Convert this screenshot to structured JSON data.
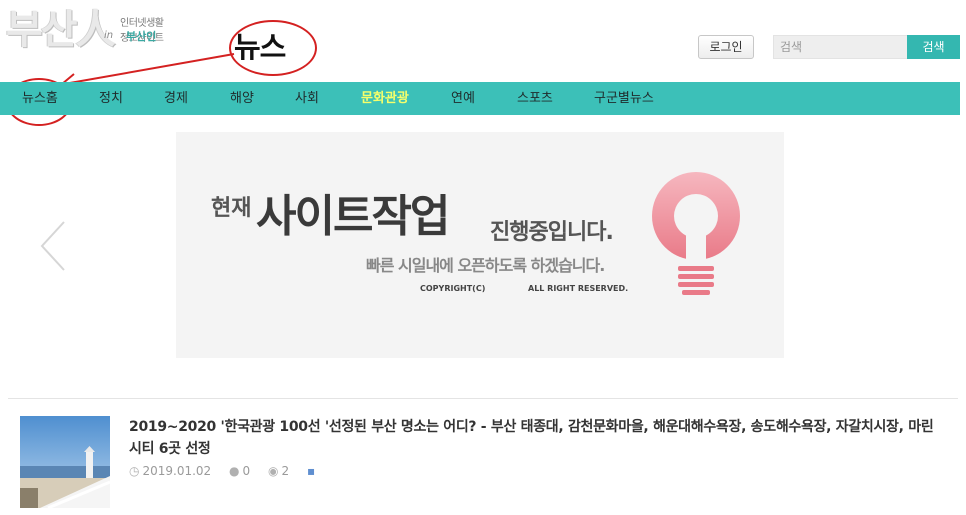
{
  "header": {
    "logo_text": "부산人",
    "logo_sup": "in",
    "logo_tagline": "인터넷생활정보사이트",
    "logo_sub": "부산인",
    "login_label": "로그인",
    "search_placeholder": "검색",
    "search_button": "검색"
  },
  "annotation": {
    "label": "뉴스"
  },
  "nav": {
    "items": [
      {
        "label": "뉴스홈"
      },
      {
        "label": "정치"
      },
      {
        "label": "경제"
      },
      {
        "label": "해양"
      },
      {
        "label": "사회"
      },
      {
        "label": "문화관광",
        "active": true
      },
      {
        "label": "연예"
      },
      {
        "label": "스포츠"
      },
      {
        "label": "구군별뉴스"
      }
    ]
  },
  "banner": {
    "prefix": "현재",
    "main": "사이트작업",
    "tail": "진행중입니다.",
    "sub": "빠른 시일내에 오픈하도록 하겠습니다.",
    "copyright": "COPYRIGHT(C)",
    "rights": "ALL RIGHT RESERVED."
  },
  "news": {
    "title": "2019~2020 '한국관광 100선 '선정된 부산 명소는 어디? - 부산 태종대, 감천문화마을, 해운대해수욕장, 송도해수욕장, 자갈치시장, 마린시티 6곳 선정",
    "date": "2019.01.02",
    "comments": "0",
    "views": "2"
  },
  "colors": {
    "nav_bg": "#3cc0b8",
    "nav_active": "#f6ff6a",
    "search_button_bg": "#34b7b0",
    "annotation_red": "#d42121"
  },
  "icons": [
    "clock-icon",
    "comment-icon",
    "eye-icon",
    "save-icon",
    "chevron-left-icon",
    "lightbulb-icon"
  ]
}
